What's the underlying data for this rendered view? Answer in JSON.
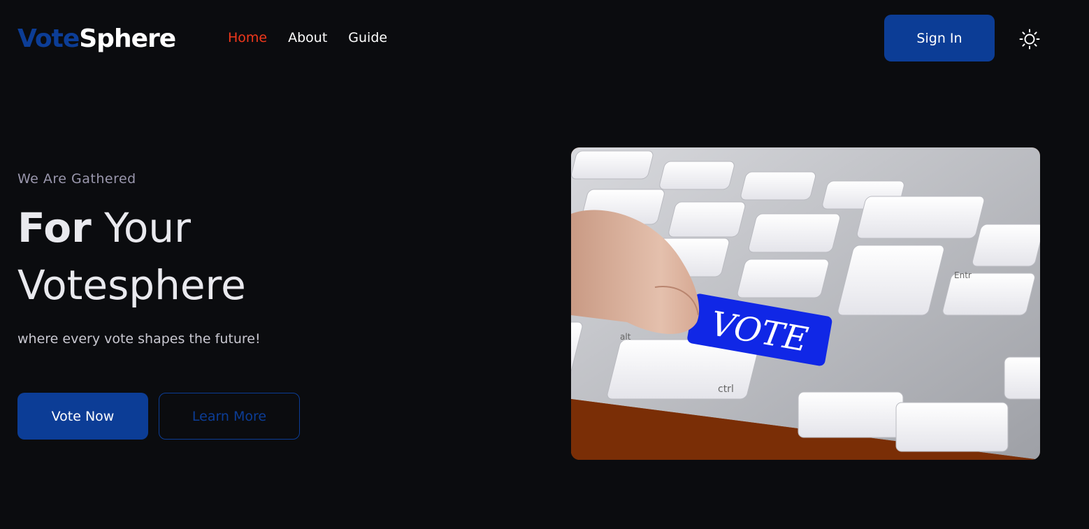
{
  "brand": {
    "part1": "Vote",
    "part2": "Sphere"
  },
  "nav": {
    "items": [
      {
        "label": "Home"
      },
      {
        "label": "About"
      },
      {
        "label": "Guide"
      }
    ]
  },
  "header": {
    "signin_label": "Sign In"
  },
  "hero": {
    "eyebrow": "We Are Gathered",
    "title_bold": "For",
    "title_rest_line1": " Your",
    "title_line2": "Votesphere",
    "tagline": "where every vote shapes the future!",
    "primary_button": "Vote Now",
    "secondary_button": "Learn More",
    "image_key_text": "VOTE",
    "image_small_keys": [
      "alt",
      "ctrl",
      "Entr"
    ]
  },
  "colors": {
    "background": "#0b0c0f",
    "brand_blue": "#0c3d96",
    "active_nav": "#f0381c",
    "eyebrow": "#9a97ad"
  },
  "icons": {
    "theme_toggle": "sun-icon"
  }
}
